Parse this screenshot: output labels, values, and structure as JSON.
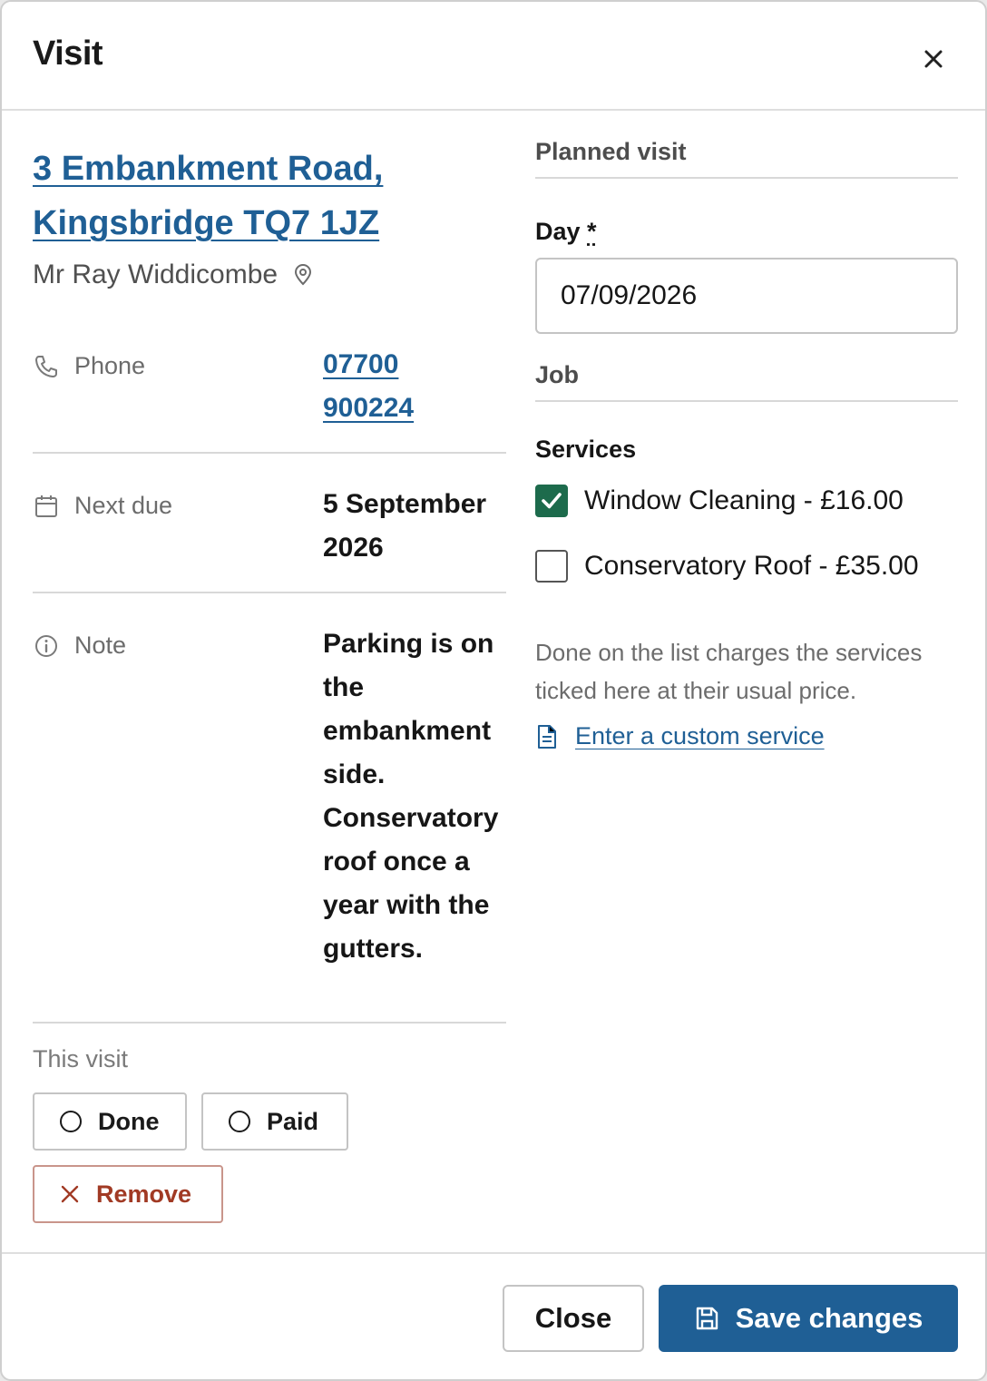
{
  "dialog": {
    "title": "Visit",
    "close_icon": "close-icon"
  },
  "customer": {
    "address_line1": "3 Embankment Road,",
    "address_line2": "Kingsbridge TQ7 1JZ",
    "name": "Mr Ray Widdicombe",
    "location_icon": "map-pin-icon"
  },
  "details": {
    "phone_label": "Phone",
    "phone_line1": "07700",
    "phone_line2": "900224",
    "next_due_label": "Next due",
    "next_due_value": "5 September 2026",
    "note_label": "Note",
    "note_value": "Parking is on the embankment side. Conservatory roof once a year with the gutters."
  },
  "this_visit": {
    "label": "This visit",
    "done_label": "Done",
    "paid_label": "Paid",
    "remove_label": "Remove"
  },
  "planned_visit": {
    "section_title": "Planned visit",
    "day_label": "Day",
    "required_marker": "*",
    "day_value": "07/09/2026"
  },
  "job": {
    "section_title": "Job",
    "services_label": "Services",
    "services": [
      {
        "label": "Window Cleaning - £16.00",
        "checked": true
      },
      {
        "label": "Conservatory Roof - £35.00",
        "checked": false
      }
    ],
    "help_text": "Done on the list charges the services ticked here at their usual price.",
    "custom_service_link": "Enter a custom service"
  },
  "footer": {
    "close_label": "Close",
    "save_label": "Save changes"
  },
  "colors": {
    "link": "#1f5f95",
    "primary": "#1f5f95",
    "checkbox": "#1d6b4c",
    "danger": "#a13a24"
  }
}
